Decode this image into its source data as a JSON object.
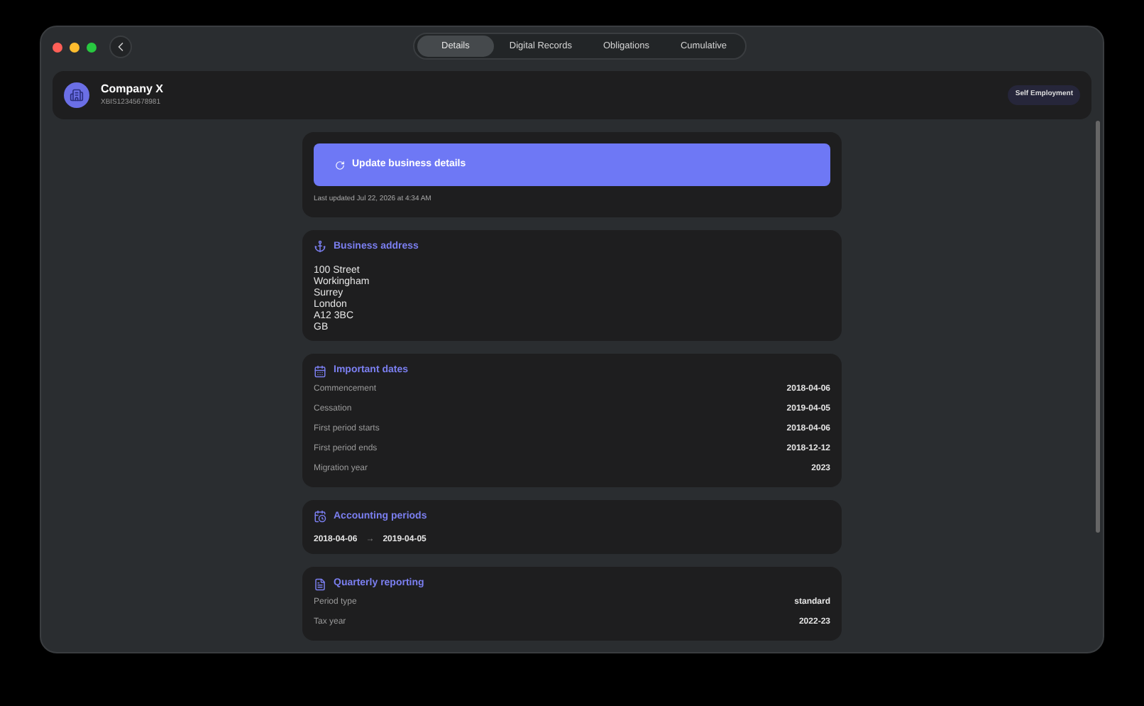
{
  "tabs": [
    {
      "label": "Details",
      "selected": true
    },
    {
      "label": "Digital Records",
      "selected": false
    },
    {
      "label": "Obligations",
      "selected": false
    },
    {
      "label": "Cumulative",
      "selected": false
    }
  ],
  "business": {
    "name": "Company X",
    "id": "XBIS12345678981",
    "badge": "Self Employment"
  },
  "update": {
    "button": "Update business details",
    "last_updated": "Last updated Jul 22, 2026 at 4:34 AM"
  },
  "sections": [
    {
      "kind": "address",
      "title": "Business address",
      "lines": [
        "100 Street",
        "Workingham",
        "Surrey",
        "London",
        "A12 3BC",
        "GB"
      ]
    },
    {
      "kind": "rows",
      "title": "Important dates",
      "rows": [
        {
          "label": "Commencement",
          "value": "2018-04-06"
        },
        {
          "label": "Cessation",
          "value": "2019-04-05"
        },
        {
          "label": "First period starts",
          "value": "2018-04-06"
        },
        {
          "label": "First period ends",
          "value": "2018-12-12"
        },
        {
          "label": "Migration year",
          "value": "2023"
        }
      ]
    },
    {
      "kind": "range",
      "title": "Accounting periods",
      "from": "2018-04-06",
      "arrow": "→",
      "to": "2019-04-05"
    },
    {
      "kind": "rows",
      "title": "Quarterly reporting",
      "rows": [
        {
          "label": "Period type",
          "value": "standard"
        },
        {
          "label": "Tax year",
          "value": "2022-23"
        }
      ]
    }
  ]
}
